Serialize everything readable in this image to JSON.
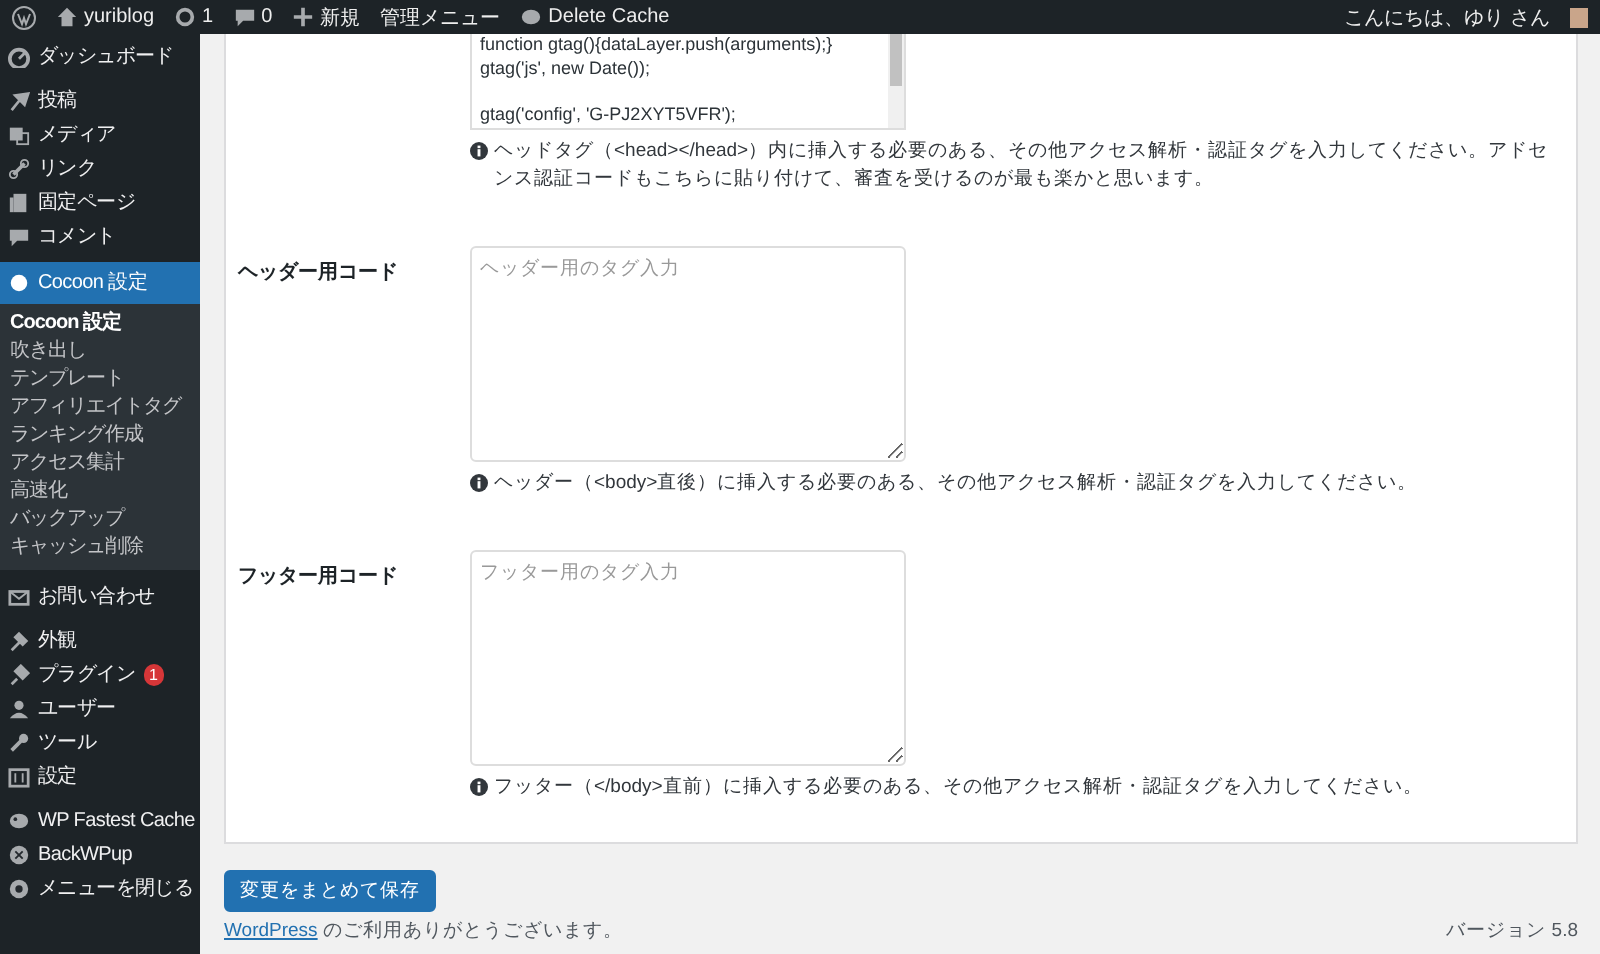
{
  "admin_bar": {
    "site": "yuriblog",
    "updates": "1",
    "comments": "0",
    "new": "新規",
    "admin_menu": "管理メニュー",
    "delete_cache": "Delete Cache",
    "greeting": "こんにちは、ゆり さん"
  },
  "sidebar": {
    "items": [
      {
        "label": "ダッシュボード",
        "selected": false
      },
      {
        "label": "投稿",
        "selected": false
      },
      {
        "label": "メディア",
        "selected": false
      },
      {
        "label": "リンク",
        "selected": false
      },
      {
        "label": "固定ページ",
        "selected": false
      },
      {
        "label": "コメント",
        "selected": false
      },
      {
        "label": "Cocoon 設定",
        "selected": true,
        "children": [
          {
            "label": "Cocoon 設定",
            "selected": true
          },
          {
            "label": "吹き出し",
            "selected": false
          },
          {
            "label": "テンプレート",
            "selected": false
          },
          {
            "label": "アフィリエイトタグ",
            "selected": false
          },
          {
            "label": "ランキング作成",
            "selected": false
          },
          {
            "label": "アクセス集計",
            "selected": false
          },
          {
            "label": "高速化",
            "selected": false
          },
          {
            "label": "バックアップ",
            "selected": false
          },
          {
            "label": "キャッシュ削除",
            "selected": false
          }
        ]
      },
      {
        "label": "お問い合わせ",
        "selected": false
      },
      {
        "label": "外観",
        "selected": false
      },
      {
        "label": "プラグイン",
        "selected": false,
        "badge": "1"
      },
      {
        "label": "ユーザー",
        "selected": false
      },
      {
        "label": "ツール",
        "selected": false
      },
      {
        "label": "設定",
        "selected": false
      },
      {
        "label": "WP Fastest Cache",
        "selected": false
      },
      {
        "label": "BackWPup",
        "selected": false
      },
      {
        "label": "メニューを閉じる",
        "selected": false
      }
    ]
  },
  "sections": [
    {
      "blocks": [
        [
          "function gtag(){dataLayer.push(arguments);}",
          "gtag('js', new Date());"
        ],
        [
          "gtag('config', 'G-PJ2XYT5VFR');"
        ]
      ],
      "note": "ヘッドタグ（<head></head>）内に挿入する必要のある、その他アクセス解析・認証タグを入力してください。アドセンス認証コードもこちらに貼り付けて、審査を受けるのが最も楽かと思います。"
    },
    {
      "label": "ヘッダー用コード",
      "placeholder": "ヘッダー用のタグ入力",
      "note": "ヘッダー（<body>直後）に挿入する必要のある、その他アクセス解析・認証タグを入力してください。"
    },
    {
      "label": "フッター用コード",
      "placeholder": "フッター用のタグ入力",
      "note": "フッター（</body>直前）に挿入する必要のある、その他アクセス解析・認証タグを入力してください。"
    }
  ],
  "save_button": "変更をまとめて保存",
  "footer": {
    "link": "WordPress",
    "thanks": "のご利用ありがとうございます。",
    "version": "バージョン 5.8"
  }
}
